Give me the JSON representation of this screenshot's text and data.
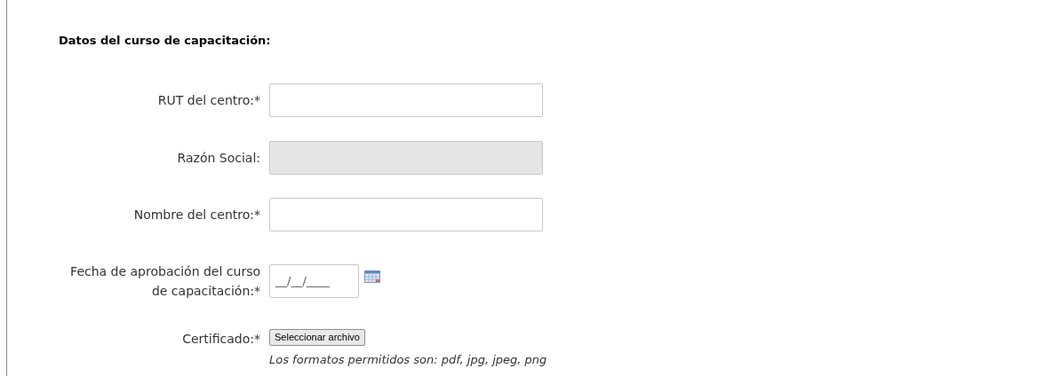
{
  "section_title": "Datos del curso de capacitación:",
  "fields": [
    {
      "kind": "text",
      "label": "RUT del centro:*",
      "disabled": false
    },
    {
      "kind": "text",
      "label": "Razón Social:",
      "disabled": true
    },
    {
      "kind": "text",
      "label": "Nombre del centro:*",
      "disabled": false
    },
    {
      "kind": "date",
      "label": "Fecha de aprobación del curso de capacitación:*",
      "value": "__/__/____"
    },
    {
      "kind": "file",
      "label": "Certificado:*",
      "button": "Seleccionar archivo",
      "hint": "Los formatos permitidos son: pdf, jpg, jpeg, png"
    }
  ]
}
